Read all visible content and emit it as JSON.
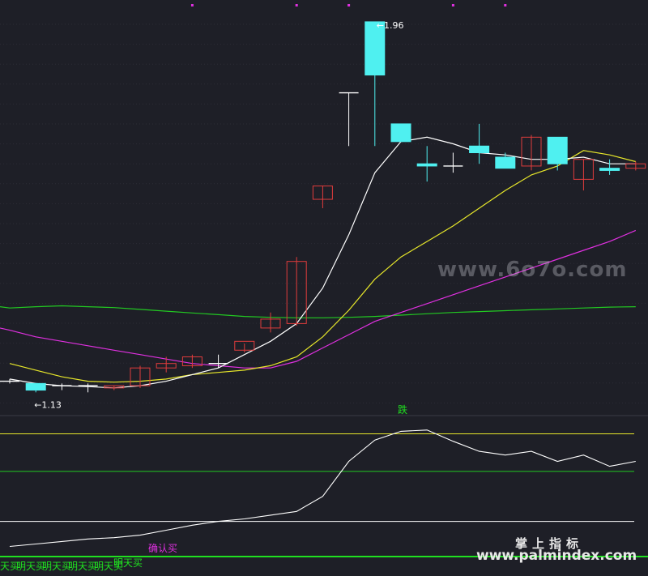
{
  "chart_data": [
    {
      "type": "candlestick",
      "price_labels": {
        "high": "1.96",
        "low": "1.13"
      },
      "candles": [
        {
          "o": 1.15,
          "h": 1.155,
          "l": 1.145,
          "c": 1.15
        },
        {
          "o": 1.145,
          "h": 1.145,
          "l": 1.125,
          "c": 1.13
        },
        {
          "o": 1.14,
          "h": 1.145,
          "l": 1.13,
          "c": 1.14
        },
        {
          "o": 1.14,
          "h": 1.145,
          "l": 1.125,
          "c": 1.14
        },
        {
          "o": 1.135,
          "h": 1.14,
          "l": 1.13,
          "c": 1.14
        },
        {
          "o": 1.14,
          "h": 1.185,
          "l": 1.135,
          "c": 1.18
        },
        {
          "o": 1.18,
          "h": 1.205,
          "l": 1.17,
          "c": 1.19
        },
        {
          "o": 1.185,
          "h": 1.21,
          "l": 1.18,
          "c": 1.205
        },
        {
          "o": 1.19,
          "h": 1.21,
          "l": 1.18,
          "c": 1.19
        },
        {
          "o": 1.22,
          "h": 1.235,
          "l": 1.215,
          "c": 1.24
        },
        {
          "o": 1.27,
          "h": 1.305,
          "l": 1.26,
          "c": 1.29
        },
        {
          "o": 1.28,
          "h": 1.43,
          "l": 1.275,
          "c": 1.42
        },
        {
          "o": 1.56,
          "h": 1.59,
          "l": 1.54,
          "c": 1.59
        },
        {
          "o": 1.8,
          "h": 1.8,
          "l": 1.68,
          "c": 1.8
        },
        {
          "o": 1.96,
          "h": 1.96,
          "l": 1.68,
          "c": 1.84
        },
        {
          "o": 1.73,
          "h": 1.73,
          "l": 1.69,
          "c": 1.69
        },
        {
          "o": 1.64,
          "h": 1.68,
          "l": 1.6,
          "c": 1.635
        },
        {
          "o": 1.635,
          "h": 1.665,
          "l": 1.62,
          "c": 1.635
        },
        {
          "o": 1.68,
          "h": 1.73,
          "l": 1.64,
          "c": 1.665
        },
        {
          "o": 1.655,
          "h": 1.665,
          "l": 1.63,
          "c": 1.63
        },
        {
          "o": 1.635,
          "h": 1.705,
          "l": 1.625,
          "c": 1.7
        },
        {
          "o": 1.7,
          "h": 1.7,
          "l": 1.625,
          "c": 1.64
        },
        {
          "o": 1.605,
          "h": 1.65,
          "l": 1.58,
          "c": 1.65
        },
        {
          "o": 1.63,
          "h": 1.65,
          "l": 1.615,
          "c": 1.625
        },
        {
          "o": 1.63,
          "h": 1.645,
          "l": 1.625,
          "c": 1.64
        }
      ],
      "ma_white": [
        1.155,
        1.145,
        1.14,
        1.138,
        1.135,
        1.14,
        1.15,
        1.165,
        1.18,
        1.21,
        1.24,
        1.28,
        1.36,
        1.48,
        1.62,
        1.69,
        1.7,
        1.685,
        1.665,
        1.66,
        1.65,
        1.65,
        1.655,
        1.64,
        1.64
      ],
      "ma_yellow": [
        1.19,
        1.175,
        1.16,
        1.15,
        1.148,
        1.15,
        1.155,
        1.165,
        1.17,
        1.175,
        1.185,
        1.205,
        1.25,
        1.31,
        1.38,
        1.43,
        1.465,
        1.5,
        1.54,
        1.58,
        1.615,
        1.635,
        1.67,
        1.66,
        1.645
      ],
      "ma_magenta": [
        1.265,
        1.25,
        1.24,
        1.23,
        1.22,
        1.21,
        1.2,
        1.19,
        1.185,
        1.18,
        1.18,
        1.195,
        1.225,
        1.255,
        1.285,
        1.305,
        1.325,
        1.345,
        1.365,
        1.385,
        1.405,
        1.425,
        1.445,
        1.465,
        1.49
      ],
      "ma_green": [
        1.315,
        1.318,
        1.32,
        1.318,
        1.316,
        1.312,
        1.308,
        1.304,
        1.3,
        1.296,
        1.294,
        1.293,
        1.293,
        1.294,
        1.296,
        1.299,
        1.302,
        1.305,
        1.307,
        1.309,
        1.311,
        1.313,
        1.315,
        1.317,
        1.318
      ],
      "top_markers": [
        7,
        11,
        13,
        17,
        19
      ]
    },
    {
      "type": "line",
      "levels": {
        "yellow": 90,
        "green": 60,
        "white": 20
      },
      "values": [
        0,
        2,
        4,
        6,
        7,
        9,
        13,
        17,
        20,
        22,
        25,
        28,
        40,
        68,
        85,
        92,
        93,
        84,
        76,
        73,
        76,
        68,
        73,
        64,
        68
      ],
      "signals": {
        "sell_label": "跌",
        "buy_confirm_label": "确认买",
        "buy_label": "明天买",
        "buy_label_clipped": "天买"
      }
    }
  ],
  "watermark": {
    "main": "www.6o7o.com",
    "cn": "掌上指标",
    "url": "www.palmindex.com"
  },
  "colors": {
    "background": "#1e1f27",
    "bull": "#e03c3c",
    "bear": "#4ff0f0",
    "ma_white": "#ffffff",
    "ma_yellow": "#e7e72a",
    "ma_magenta": "#e030e0",
    "ma_green": "#22c922",
    "signal_green": "#20e020",
    "signal_magenta": "#e030e0",
    "grid": "#3a3b44"
  }
}
